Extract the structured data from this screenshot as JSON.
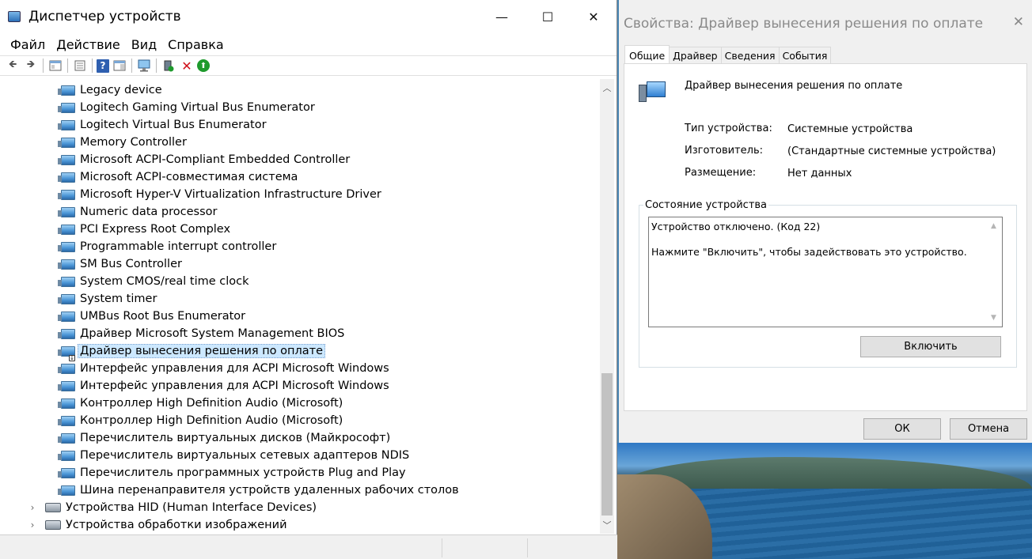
{
  "device_manager": {
    "title": "Диспетчер устройств",
    "window_buttons": {
      "minimize": "—",
      "maximize": "☐",
      "close": "✕"
    },
    "menu": [
      "Файл",
      "Действие",
      "Вид",
      "Справка"
    ],
    "toolbar": {
      "back": "🡸",
      "forward": "🡺",
      "help": "?",
      "remove": "✕",
      "update": "⬆"
    },
    "tree_items": [
      "Legacy device",
      "Logitech Gaming Virtual Bus Enumerator",
      "Logitech Virtual Bus Enumerator",
      "Memory Controller",
      "Microsoft ACPI-Compliant Embedded Controller",
      "Microsoft ACPI-совместимая система",
      "Microsoft Hyper-V Virtualization Infrastructure Driver",
      "Numeric data processor",
      "PCI Express Root Complex",
      "Programmable interrupt controller",
      "SM Bus Controller",
      "System CMOS/real time clock",
      "System timer",
      "UMBus Root Bus Enumerator",
      "Драйвер Microsoft System Management BIOS",
      "Драйвер вынесения решения по оплате",
      "Интерфейс управления для ACPI Microsoft Windows",
      "Интерфейс управления для ACPI Microsoft Windows",
      "Контроллер High Definition Audio (Microsoft)",
      "Контроллер High Definition Audio (Microsoft)",
      "Перечислитель виртуальных дисков (Майкрософт)",
      "Перечислитель виртуальных сетевых адаптеров NDIS",
      "Перечислитель программных устройств Plug and Play",
      "Шина перенаправителя устройств удаленных рабочих столов"
    ],
    "selected_index": 15,
    "categories": [
      {
        "label": "Устройства HID (Human Interface Devices)",
        "expander": "›"
      },
      {
        "label": "Устройства обработки изображений",
        "expander": "›"
      }
    ],
    "scroll": {
      "up": "︿",
      "down": "﹀"
    }
  },
  "properties": {
    "title": "Свойства: Драйвер вынесения решения по оплате",
    "close": "✕",
    "tabs": [
      "Общие",
      "Драйвер",
      "Сведения",
      "События"
    ],
    "active_tab": 0,
    "device_name": "Драйвер вынесения решения по оплате",
    "fields": [
      {
        "key": "Тип устройства:",
        "value": "Системные устройства"
      },
      {
        "key": "Изготовитель:",
        "value": "(Стандартные системные устройства)"
      },
      {
        "key": "Размещение:",
        "value": "Нет данных"
      }
    ],
    "status_group_title": "Состояние устройства",
    "status_lines": [
      "Устройство отключено. (Код 22)",
      "Нажмите \"Включить\", чтобы задействовать это устройство."
    ],
    "status_scroll": {
      "up": "▲",
      "down": "▼"
    },
    "enable_button": "Включить",
    "ok_button": "ОК",
    "cancel_button": "Отмена"
  }
}
